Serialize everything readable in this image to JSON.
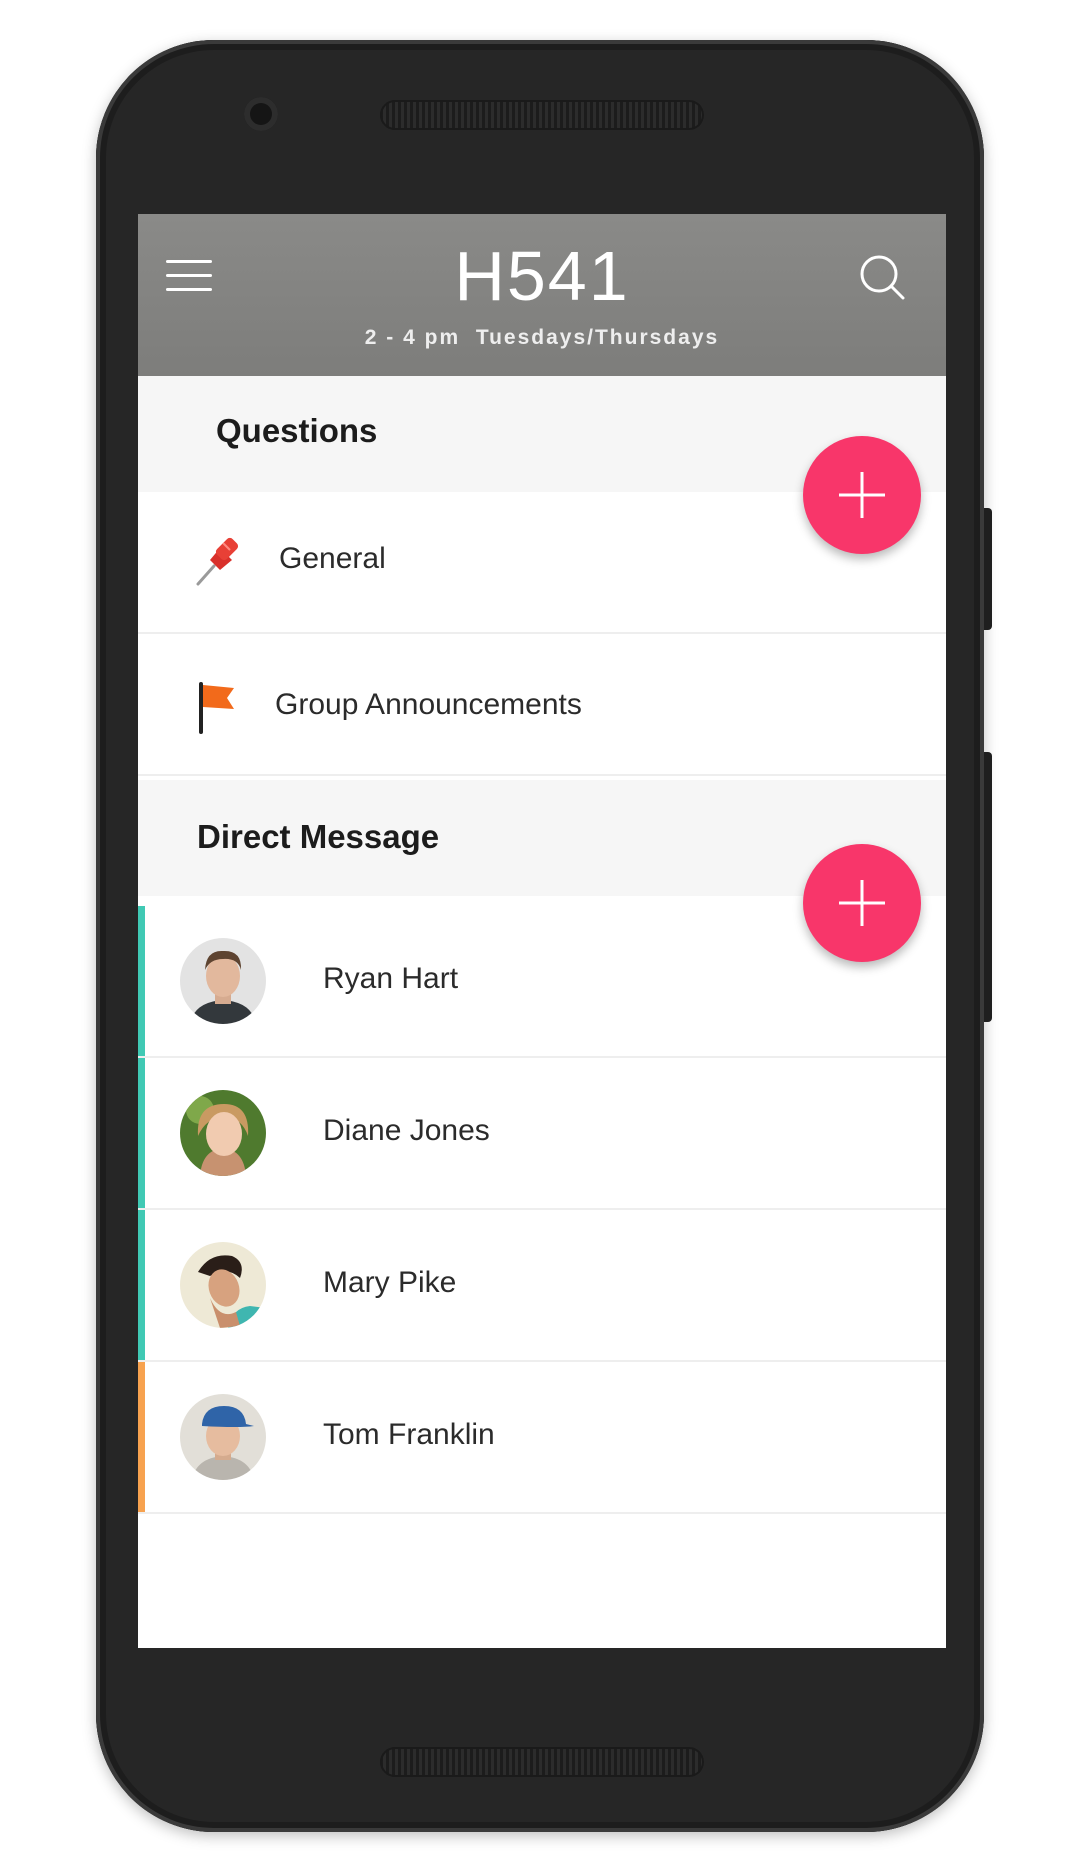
{
  "header": {
    "title": "H541",
    "subtitle": "2 - 4 pm  Tuesdays/Thursdays",
    "menu_icon": "hamburger-menu-icon",
    "search_icon": "search-icon",
    "background_color": "#808080"
  },
  "questions": {
    "title": "Questions",
    "add_icon": "plus-icon",
    "items": [
      {
        "label": "General",
        "icon": "pushpin-icon"
      },
      {
        "label": "Group Announcements",
        "icon": "flag-icon"
      }
    ]
  },
  "direct_message": {
    "title": "Direct Message",
    "add_icon": "plus-icon",
    "items": [
      {
        "name": "Ryan Hart",
        "accent_color": "#40c9b4"
      },
      {
        "name": "Diane Jones",
        "accent_color": "#40c9b4"
      },
      {
        "name": "Mary Pike",
        "accent_color": "#40c9b4"
      },
      {
        "name": "Tom Franklin",
        "accent_color": "#f7a24f"
      }
    ]
  },
  "colors": {
    "fab": "#f8366a",
    "accent_online": "#40c9b4",
    "accent_away": "#f7a24f"
  }
}
